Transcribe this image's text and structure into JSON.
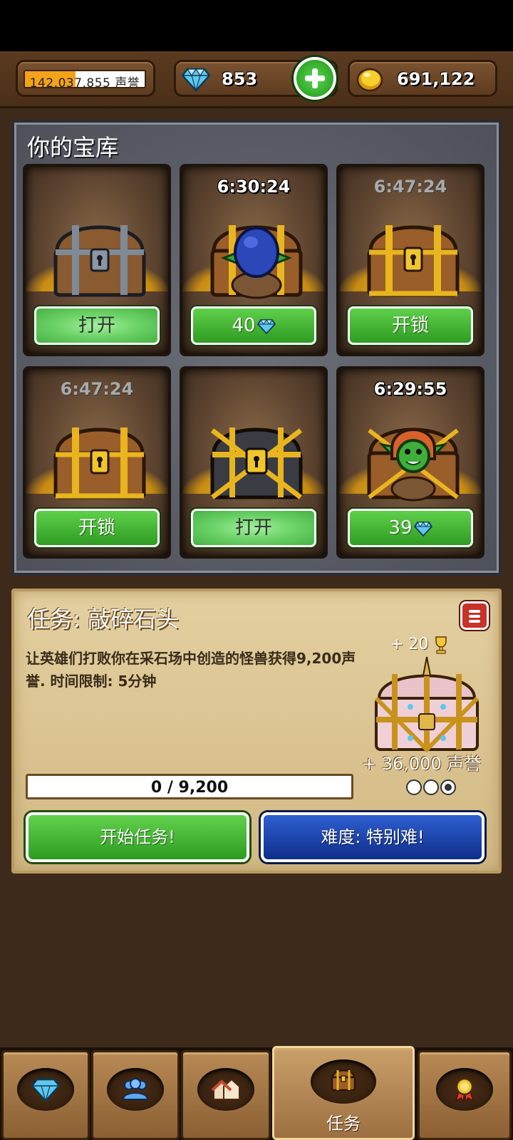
{
  "resources": {
    "reputation_text": "142,037,855 声誉",
    "reputation_fill_fraction": 0.42,
    "gems": "853",
    "gold": "691,122"
  },
  "vault": {
    "title": "你的宝库",
    "chests": [
      {
        "timer": "",
        "timer_dim": false,
        "chest": "iron-chest",
        "button_label": "打开",
        "button_style": "glow",
        "gem_icon": false
      },
      {
        "timer": "6:30:24",
        "timer_dim": false,
        "chest": "goblin-blue-chest",
        "button_label": "40",
        "button_style": "green",
        "gem_icon": true
      },
      {
        "timer": "6:47:24",
        "timer_dim": true,
        "chest": "gold-wood-chest",
        "button_label": "开锁",
        "button_style": "green",
        "gem_icon": false
      },
      {
        "timer": "6:47:24",
        "timer_dim": true,
        "chest": "gold-wood-chest",
        "button_label": "开锁",
        "button_style": "green",
        "gem_icon": false
      },
      {
        "timer": "",
        "timer_dim": false,
        "chest": "dark-gold-chest",
        "button_label": "打开",
        "button_style": "glow",
        "gem_icon": false
      },
      {
        "timer": "6:29:55",
        "timer_dim": false,
        "chest": "goblin-green-chest",
        "button_label": "39",
        "button_style": "green",
        "gem_icon": true
      }
    ]
  },
  "quest": {
    "title": "任务: 敲碎石头",
    "description": "让英雄们打败你在采石场中创造的怪兽获得9,200声誉. 时间限制: 5分钟",
    "reward_trophy": "+ 20",
    "reward_reputation": "+ 36,000 声誉",
    "stars_filled": 1,
    "stars_total": 3,
    "progress_text": "0 / 9,200",
    "progress_fraction": 0,
    "start_label": "开始任务!",
    "difficulty_label": "难度: 特别难!"
  },
  "nav": {
    "tabs": [
      {
        "name": "gems",
        "icon": "diamond-icon",
        "label": "",
        "active": false
      },
      {
        "name": "heroes",
        "icon": "people-icon",
        "label": "",
        "active": false
      },
      {
        "name": "town",
        "icon": "houses-icon",
        "label": "",
        "active": false
      },
      {
        "name": "quests",
        "icon": "chest-icon",
        "label": "任务",
        "active": true
      },
      {
        "name": "achievements",
        "icon": "medal-icon",
        "label": "",
        "active": false
      }
    ]
  },
  "colors": {
    "button_green": "#2e9c22",
    "button_blue": "#0f2e8a",
    "gold": "#f5c731",
    "gem": "#5fc7f0"
  }
}
